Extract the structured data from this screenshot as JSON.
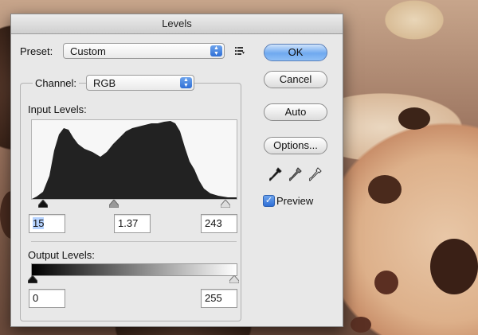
{
  "window": {
    "title": "Levels"
  },
  "preset": {
    "label": "Preset:",
    "value": "Custom"
  },
  "channel": {
    "label": "Channel:",
    "value": "RGB"
  },
  "input_levels": {
    "label": "Input Levels:",
    "black": "15",
    "gamma": "1.37",
    "white": "243"
  },
  "output_levels": {
    "label": "Output Levels:",
    "black": "0",
    "white": "255"
  },
  "buttons": {
    "ok": "OK",
    "cancel": "Cancel",
    "auto": "Auto",
    "options": "Options..."
  },
  "preview": {
    "label": "Preview",
    "checked": true
  },
  "colors": {
    "accent": "#3b7be0",
    "histogram": "#222222"
  }
}
